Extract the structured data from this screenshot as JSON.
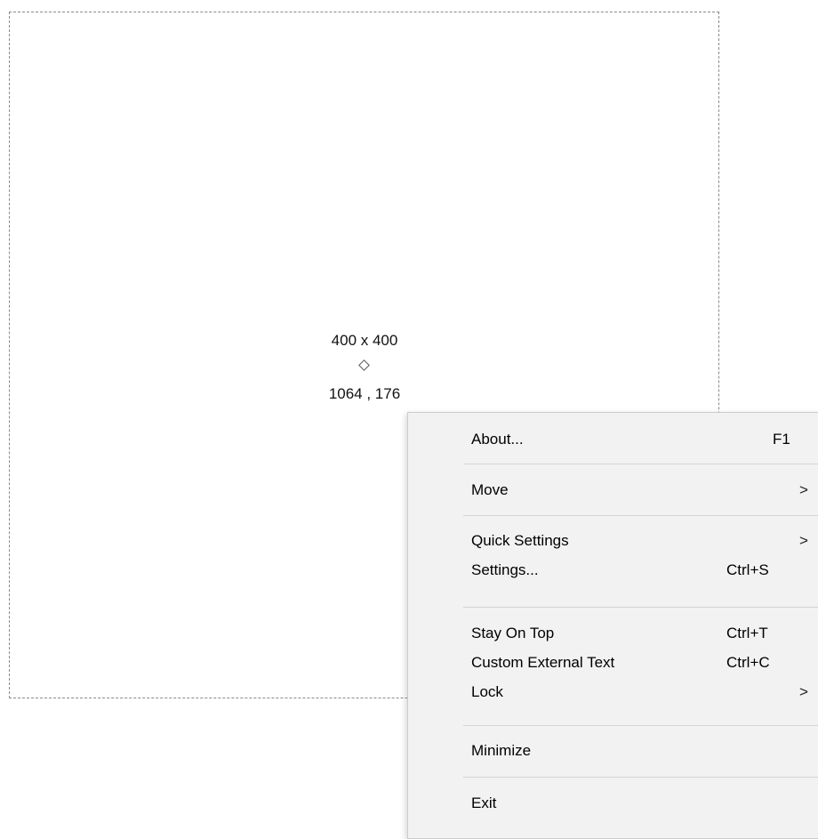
{
  "readout": {
    "size": "400 x 400",
    "coordinates": "1064 , 176"
  },
  "menu": {
    "items": [
      {
        "label": "About...",
        "shortcut": "F1",
        "submenu": false
      },
      {
        "label": "Move",
        "shortcut": "",
        "submenu": true
      },
      {
        "label": "Quick Settings",
        "shortcut": "",
        "submenu": true
      },
      {
        "label": "Settings...",
        "shortcut": "Ctrl+S",
        "submenu": false
      },
      {
        "label": "Stay On Top",
        "shortcut": "Ctrl+T",
        "submenu": false
      },
      {
        "label": "Custom External Text",
        "shortcut": "Ctrl+C",
        "submenu": false
      },
      {
        "label": "Lock",
        "shortcut": "",
        "submenu": true
      },
      {
        "label": "Minimize",
        "shortcut": "",
        "submenu": false
      },
      {
        "label": "Exit",
        "shortcut": "",
        "submenu": false
      }
    ],
    "submenu_arrow": ">"
  }
}
